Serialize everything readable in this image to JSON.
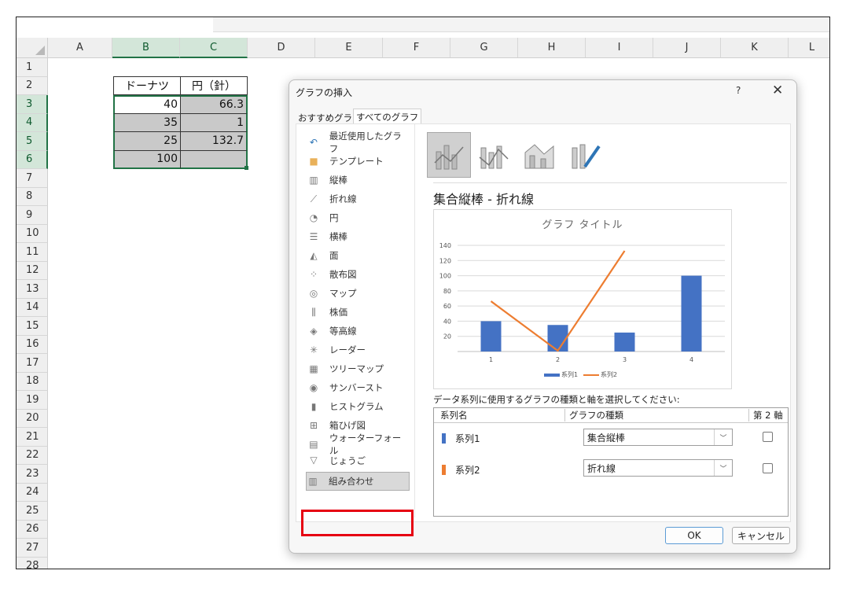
{
  "sheet": {
    "columns": [
      "A",
      "B",
      "C",
      "D",
      "E",
      "F",
      "G",
      "H",
      "I",
      "J",
      "K",
      "L"
    ],
    "rows": [
      "1",
      "2",
      "3",
      "4",
      "5",
      "6",
      "7",
      "8",
      "9",
      "10",
      "11",
      "12",
      "13",
      "14",
      "15",
      "16",
      "17",
      "18",
      "19",
      "20",
      "21",
      "22",
      "23",
      "24",
      "25",
      "26",
      "27",
      "28"
    ],
    "header_b": "ドーナツ",
    "header_c": "円（針）",
    "b_values": [
      "40",
      "35",
      "25",
      "100"
    ],
    "c_values": [
      "66.3",
      "1",
      "132.7",
      ""
    ]
  },
  "dialog": {
    "title": "グラフの挿入",
    "help": "?",
    "close": "✕",
    "tabs": [
      "おすすめグラフ",
      "すべてのグラフ"
    ],
    "categories": [
      {
        "label": "最近使用したグラフ",
        "icon": "recent-icon"
      },
      {
        "label": "テンプレート",
        "icon": "folder-icon"
      },
      {
        "label": "縦棒",
        "icon": "column-chart-icon"
      },
      {
        "label": "折れ線",
        "icon": "line-chart-icon"
      },
      {
        "label": "円",
        "icon": "pie-chart-icon"
      },
      {
        "label": "横棒",
        "icon": "bar-chart-icon"
      },
      {
        "label": "面",
        "icon": "area-chart-icon"
      },
      {
        "label": "散布図",
        "icon": "scatter-chart-icon"
      },
      {
        "label": "マップ",
        "icon": "map-chart-icon"
      },
      {
        "label": "株価",
        "icon": "stock-chart-icon"
      },
      {
        "label": "等高線",
        "icon": "surface-chart-icon"
      },
      {
        "label": "レーダー",
        "icon": "radar-chart-icon"
      },
      {
        "label": "ツリーマップ",
        "icon": "treemap-icon"
      },
      {
        "label": "サンバースト",
        "icon": "sunburst-icon"
      },
      {
        "label": "ヒストグラム",
        "icon": "histogram-icon"
      },
      {
        "label": "箱ひげ図",
        "icon": "boxplot-icon"
      },
      {
        "label": "ウォーターフォール",
        "icon": "waterfall-icon"
      },
      {
        "label": "じょうご",
        "icon": "funnel-icon"
      },
      {
        "label": "組み合わせ",
        "icon": "combo-chart-icon"
      }
    ],
    "combo_title": "集合縦棒 - 折れ線",
    "instruction": "データ系列に使用するグラフの種類と軸を選択してください:",
    "grid_headers": {
      "name": "系列名",
      "type": "グラフの種類",
      "axis": "第 2 軸"
    },
    "series_rows": [
      {
        "name": "系列1",
        "type": "集合縦棒",
        "color": "#4472c4"
      },
      {
        "name": "系列2",
        "type": "折れ線",
        "color": "#ed7d31"
      }
    ],
    "ok_label": "OK",
    "cancel_label": "キャンセル"
  },
  "chart_data": {
    "type": "bar",
    "title": "グラフ タイトル",
    "categories": [
      "1",
      "2",
      "3",
      "4"
    ],
    "series": [
      {
        "name": "系列1",
        "kind": "bar",
        "color": "#4472c4",
        "values": [
          40,
          35,
          25,
          100
        ]
      },
      {
        "name": "系列2",
        "kind": "line",
        "color": "#ed7d31",
        "values": [
          66.3,
          1,
          132.7,
          null
        ]
      }
    ],
    "y_ticks": [
      "20",
      "40",
      "60",
      "80",
      "100",
      "120",
      "140"
    ],
    "ylim": [
      0,
      140
    ],
    "grid": true,
    "legend": "bottom"
  }
}
